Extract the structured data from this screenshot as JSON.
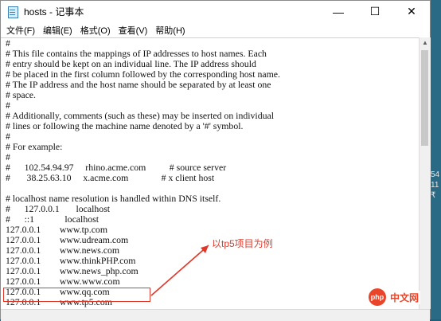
{
  "window": {
    "title": "hosts - 记事本",
    "minimize_glyph": "—",
    "maximize_glyph": "☐",
    "close_glyph": "✕"
  },
  "menu": {
    "file": "文件(F)",
    "edit": "编辑(E)",
    "format": "格式(O)",
    "view": "查看(V)",
    "help": "帮助(H)"
  },
  "content": {
    "lines": [
      "#",
      "# This file contains the mappings of IP addresses to host names. Each",
      "# entry should be kept on an individual line. The IP address should",
      "# be placed in the first column followed by the corresponding host name.",
      "# The IP address and the host name should be separated by at least one",
      "# space.",
      "#",
      "# Additionally, comments (such as these) may be inserted on individual",
      "# lines or following the machine name denoted by a '#' symbol.",
      "#",
      "# For example:",
      "#",
      "#      102.54.94.97     rhino.acme.com          # source server",
      "#       38.25.63.10     x.acme.com              # x client host",
      "",
      "# localhost name resolution is handled within DNS itself.",
      "#      127.0.0.1       localhost",
      "#      ::1             localhost",
      "127.0.0.1        www.tp.com",
      "127.0.0.1        www.udream.com",
      "127.0.0.1        www.news.com",
      "127.0.0.1        www.thinkPHP.com",
      "127.0.0.1        www.news_php.com",
      "127.0.0.1        www.www.com",
      "127.0.0.1        www.qq.com",
      "127.0.0.1        www.tp5.com"
    ]
  },
  "annotation": {
    "label": "以tp5项目为例",
    "color": "#e0392b"
  },
  "background": {
    "side_numbers": [
      "54",
      "11",
      "₹"
    ]
  },
  "watermark": {
    "logo_text": "php",
    "text": "中文网"
  },
  "icons": {
    "app": "notepad-icon"
  }
}
